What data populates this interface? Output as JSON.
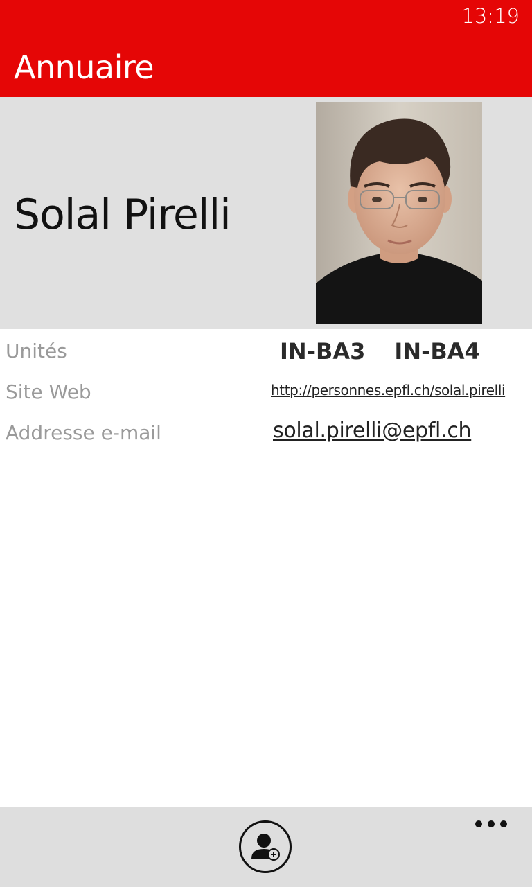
{
  "status_bar": {
    "time": "13:19"
  },
  "app": {
    "title": "Annuaire",
    "accent_color": "#e50606"
  },
  "person": {
    "name": "Solal Pirelli",
    "photo": "portrait-photo"
  },
  "details": {
    "units_label": "Unités",
    "units": [
      "IN-BA3",
      "IN-BA4"
    ],
    "website_label": "Site Web",
    "website": "http://personnes.epfl.ch/solal.pirelli",
    "email_label": "Addresse e-mail",
    "email": "solal.pirelli@epfl.ch"
  },
  "app_bar": {
    "add_contact_icon": "add-contact-icon",
    "more_icon": "ellipsis-icon"
  }
}
